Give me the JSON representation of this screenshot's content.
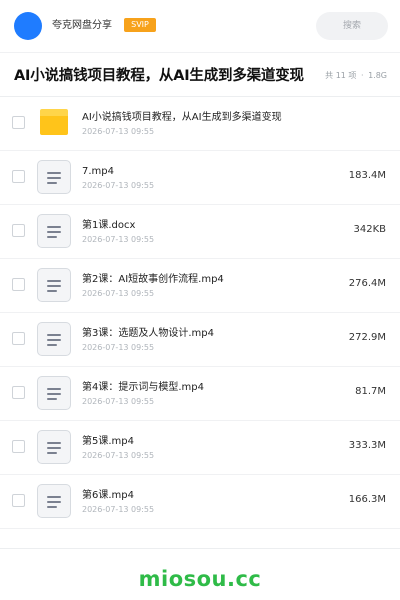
{
  "header": {
    "brand": "夸克网盘分享",
    "badge": "SVIP",
    "search_label": "搜索"
  },
  "share": {
    "title": "AI小说搞钱项目教程，从AI生成到多渠道变现",
    "count": "共 11 项",
    "separator": "·",
    "total_size": "1.8G"
  },
  "files": [
    {
      "type": "folder",
      "name": "AI小说搞钱项目教程，从AI生成到多渠道变现",
      "date": "2026-07-13 09:55",
      "size": ""
    },
    {
      "type": "file",
      "name": "7.mp4",
      "date": "2026-07-13 09:55",
      "size": "183.4M"
    },
    {
      "type": "file",
      "name": "第1课.docx",
      "date": "2026-07-13 09:55",
      "size": "342KB"
    },
    {
      "type": "file",
      "name": "第2课：AI短故事创作流程.mp4",
      "date": "2026-07-13 09:55",
      "size": "276.4M"
    },
    {
      "type": "file",
      "name": "第3课：选题及人物设计.mp4",
      "date": "2026-07-13 09:55",
      "size": "272.9M"
    },
    {
      "type": "file",
      "name": "第4课：提示词与模型.mp4",
      "date": "2026-07-13 09:55",
      "size": "81.7M"
    },
    {
      "type": "file",
      "name": "第5课.mp4",
      "date": "2026-07-13 09:55",
      "size": "333.3M"
    },
    {
      "type": "file",
      "name": "第6课.mp4",
      "date": "2026-07-13 09:55",
      "size": "166.3M"
    }
  ],
  "watermark": "miosou.cc",
  "colors": {
    "avatar": "#1f7cff",
    "badge": "#f7a21b",
    "folder": "#ffc41a",
    "watermark": "#2fbb48"
  }
}
